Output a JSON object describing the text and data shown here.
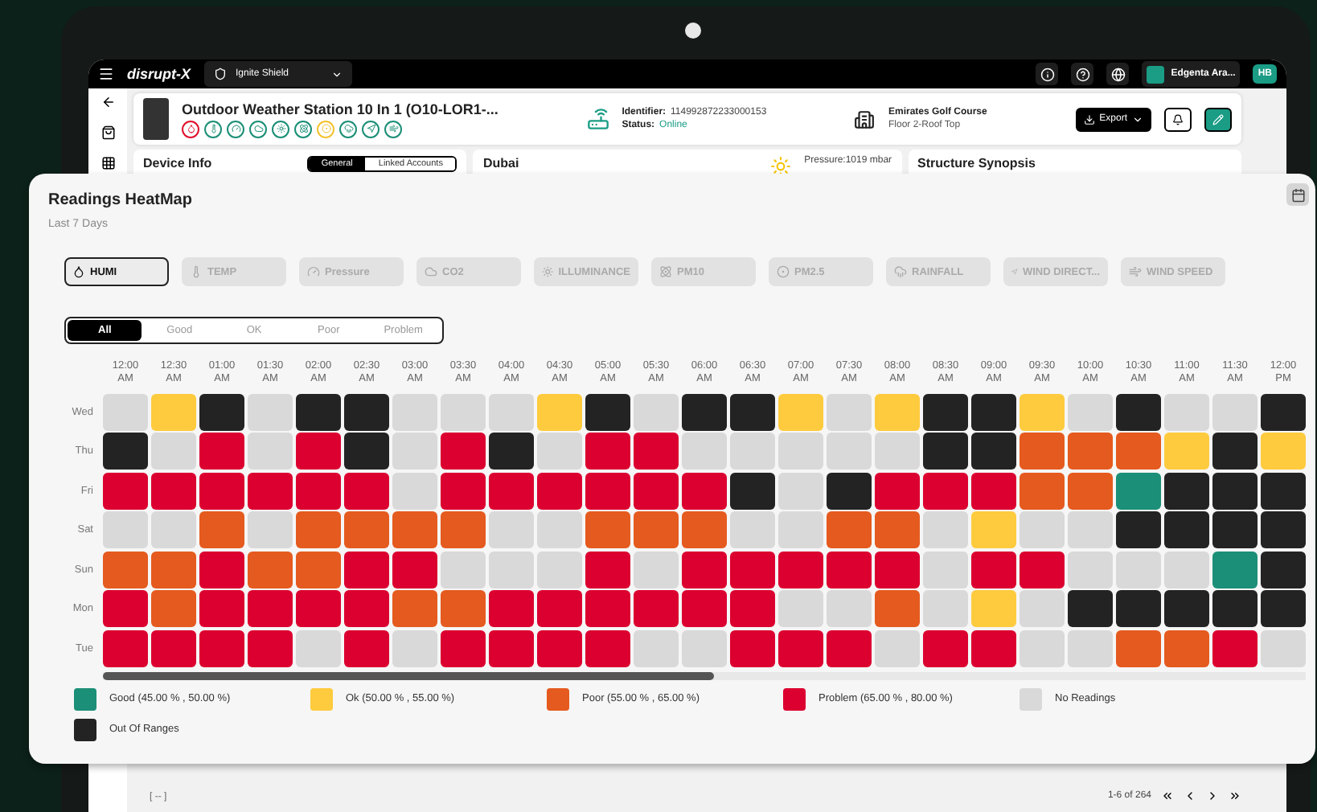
{
  "topbar": {
    "logo": "disrupt-X",
    "site": "Ignite Shield",
    "user": "Edgenta Ara...",
    "initials": "HB"
  },
  "device": {
    "title": "Outdoor Weather Station 10 In 1 (O10-LOR1-...",
    "identifier_label": "Identifier:",
    "identifier": "114992872233000153",
    "status_label": "Status:",
    "status": "Online",
    "location": "Emirates Golf Course",
    "floor": "Floor 2-Roof Top",
    "export": "Export",
    "sensors": [
      {
        "kind": "humi",
        "color": "#e0112b"
      },
      {
        "kind": "temp",
        "color": "#1b8f77"
      },
      {
        "kind": "pressure",
        "color": "#1b8f77"
      },
      {
        "kind": "co2",
        "color": "#1b8f77"
      },
      {
        "kind": "illuminance",
        "color": "#1b8f77"
      },
      {
        "kind": "pm10",
        "color": "#1b8f77"
      },
      {
        "kind": "pm25",
        "color": "#f2c230"
      },
      {
        "kind": "rainfall",
        "color": "#1b8f77"
      },
      {
        "kind": "wind-direction",
        "color": "#1b8f77"
      },
      {
        "kind": "wind-speed",
        "color": "#1b8f77"
      }
    ]
  },
  "panels": {
    "device_info": "Device Info",
    "tabs": [
      {
        "label": "General",
        "selected": true
      },
      {
        "label": "Linked Accounts",
        "selected": false
      }
    ],
    "city": "Dubai",
    "pressure": "Pressure:1019 mbar",
    "synopsis": "Structure Synopsis"
  },
  "heatmap": {
    "title": "Readings HeatMap",
    "subtitle": "Last 7 Days",
    "chips": [
      {
        "label": "HUMI",
        "kind": "humi",
        "selected": true
      },
      {
        "label": "TEMP",
        "kind": "temp",
        "selected": false
      },
      {
        "label": "Pressure",
        "kind": "pressure",
        "selected": false
      },
      {
        "label": "CO2",
        "kind": "co2",
        "selected": false
      },
      {
        "label": "ILLUMINANCE",
        "kind": "illuminance",
        "selected": false
      },
      {
        "label": "PM10",
        "kind": "pm10",
        "selected": false
      },
      {
        "label": "PM2.5",
        "kind": "pm25",
        "selected": false
      },
      {
        "label": "RAINFALL",
        "kind": "rainfall",
        "selected": false
      },
      {
        "label": "WIND DIRECT...",
        "kind": "wind-direction",
        "selected": false
      },
      {
        "label": "WIND SPEED",
        "kind": "wind-speed",
        "selected": false
      }
    ],
    "filters": [
      {
        "label": "All",
        "selected": true
      },
      {
        "label": "Good",
        "selected": false
      },
      {
        "label": "OK",
        "selected": false
      },
      {
        "label": "Poor",
        "selected": false
      },
      {
        "label": "Problem",
        "selected": false
      }
    ],
    "times": [
      "12:00 AM",
      "12:30 AM",
      "01:00 AM",
      "01:30 AM",
      "02:00 AM",
      "02:30 AM",
      "03:00 AM",
      "03:30 AM",
      "04:00 AM",
      "04:30 AM",
      "05:00 AM",
      "05:30 AM",
      "06:00 AM",
      "06:30 AM",
      "07:00 AM",
      "07:30 AM",
      "08:00 AM",
      "08:30 AM",
      "09:00 AM",
      "09:30 AM",
      "10:00 AM",
      "10:30 AM",
      "11:00 AM",
      "11:30 AM",
      "12:00 PM"
    ],
    "rows": [
      {
        "day": "Wed",
        "cells": [
          {
            "kind": "none"
          },
          {
            "kind": "ok"
          },
          {
            "kind": "out"
          },
          {
            "kind": "none"
          },
          {
            "kind": "out"
          },
          {
            "kind": "out"
          },
          {
            "kind": "none"
          },
          {
            "kind": "none"
          },
          {
            "kind": "none"
          },
          {
            "kind": "ok"
          },
          {
            "kind": "out"
          },
          {
            "kind": "none"
          },
          {
            "kind": "out"
          },
          {
            "kind": "out"
          },
          {
            "kind": "ok"
          },
          {
            "kind": "none"
          },
          {
            "kind": "ok"
          },
          {
            "kind": "out"
          },
          {
            "kind": "out"
          },
          {
            "kind": "ok"
          },
          {
            "kind": "none"
          },
          {
            "kind": "out"
          },
          {
            "kind": "none"
          },
          {
            "kind": "none"
          },
          {
            "kind": "out"
          }
        ]
      },
      {
        "day": "Thu",
        "cells": [
          {
            "kind": "out"
          },
          {
            "kind": "none"
          },
          {
            "kind": "problem"
          },
          {
            "kind": "none"
          },
          {
            "kind": "problem"
          },
          {
            "kind": "out"
          },
          {
            "kind": "none"
          },
          {
            "kind": "problem"
          },
          {
            "kind": "out"
          },
          {
            "kind": "none"
          },
          {
            "kind": "problem"
          },
          {
            "kind": "problem"
          },
          {
            "kind": "none"
          },
          {
            "kind": "none"
          },
          {
            "kind": "none"
          },
          {
            "kind": "none"
          },
          {
            "kind": "none"
          },
          {
            "kind": "out"
          },
          {
            "kind": "out"
          },
          {
            "kind": "poor"
          },
          {
            "kind": "poor"
          },
          {
            "kind": "poor"
          },
          {
            "kind": "ok"
          },
          {
            "kind": "out"
          },
          {
            "kind": "ok"
          }
        ]
      },
      {
        "day": "Fri",
        "cells": [
          {
            "kind": "problem"
          },
          {
            "kind": "problem"
          },
          {
            "kind": "problem"
          },
          {
            "kind": "problem"
          },
          {
            "kind": "problem"
          },
          {
            "kind": "problem"
          },
          {
            "kind": "none"
          },
          {
            "kind": "problem"
          },
          {
            "kind": "problem"
          },
          {
            "kind": "problem"
          },
          {
            "kind": "problem"
          },
          {
            "kind": "problem"
          },
          {
            "kind": "problem"
          },
          {
            "kind": "out"
          },
          {
            "kind": "none"
          },
          {
            "kind": "out"
          },
          {
            "kind": "problem"
          },
          {
            "kind": "problem"
          },
          {
            "kind": "problem"
          },
          {
            "kind": "poor"
          },
          {
            "kind": "poor"
          },
          {
            "kind": "good"
          },
          {
            "kind": "out"
          },
          {
            "kind": "out"
          },
          {
            "kind": "out"
          }
        ]
      },
      {
        "day": "Sat",
        "cells": [
          {
            "kind": "none"
          },
          {
            "kind": "none"
          },
          {
            "kind": "poor"
          },
          {
            "kind": "none"
          },
          {
            "kind": "poor"
          },
          {
            "kind": "poor"
          },
          {
            "kind": "poor"
          },
          {
            "kind": "poor"
          },
          {
            "kind": "none"
          },
          {
            "kind": "none"
          },
          {
            "kind": "poor"
          },
          {
            "kind": "poor"
          },
          {
            "kind": "poor"
          },
          {
            "kind": "none"
          },
          {
            "kind": "none"
          },
          {
            "kind": "poor"
          },
          {
            "kind": "poor"
          },
          {
            "kind": "none"
          },
          {
            "kind": "ok"
          },
          {
            "kind": "none"
          },
          {
            "kind": "none"
          },
          {
            "kind": "out"
          },
          {
            "kind": "out"
          },
          {
            "kind": "out"
          },
          {
            "kind": "out"
          }
        ]
      },
      {
        "day": "Sun",
        "cells": [
          {
            "kind": "poor"
          },
          {
            "kind": "poor"
          },
          {
            "kind": "problem"
          },
          {
            "kind": "poor"
          },
          {
            "kind": "poor"
          },
          {
            "kind": "problem"
          },
          {
            "kind": "problem"
          },
          {
            "kind": "none"
          },
          {
            "kind": "none"
          },
          {
            "kind": "none"
          },
          {
            "kind": "problem"
          },
          {
            "kind": "none"
          },
          {
            "kind": "problem"
          },
          {
            "kind": "problem"
          },
          {
            "kind": "problem"
          },
          {
            "kind": "problem"
          },
          {
            "kind": "problem"
          },
          {
            "kind": "none"
          },
          {
            "kind": "problem"
          },
          {
            "kind": "problem"
          },
          {
            "kind": "none"
          },
          {
            "kind": "none"
          },
          {
            "kind": "none"
          },
          {
            "kind": "good"
          },
          {
            "kind": "out"
          }
        ]
      },
      {
        "day": "Mon",
        "cells": [
          {
            "kind": "problem"
          },
          {
            "kind": "poor"
          },
          {
            "kind": "problem"
          },
          {
            "kind": "problem"
          },
          {
            "kind": "problem"
          },
          {
            "kind": "problem"
          },
          {
            "kind": "poor"
          },
          {
            "kind": "poor"
          },
          {
            "kind": "problem"
          },
          {
            "kind": "problem"
          },
          {
            "kind": "problem"
          },
          {
            "kind": "problem"
          },
          {
            "kind": "problem"
          },
          {
            "kind": "problem"
          },
          {
            "kind": "none"
          },
          {
            "kind": "none"
          },
          {
            "kind": "poor"
          },
          {
            "kind": "none"
          },
          {
            "kind": "ok"
          },
          {
            "kind": "none"
          },
          {
            "kind": "out"
          },
          {
            "kind": "out"
          },
          {
            "kind": "out"
          },
          {
            "kind": "out"
          },
          {
            "kind": "out"
          }
        ]
      },
      {
        "day": "Tue",
        "cells": [
          {
            "kind": "problem"
          },
          {
            "kind": "problem"
          },
          {
            "kind": "problem"
          },
          {
            "kind": "problem"
          },
          {
            "kind": "none"
          },
          {
            "kind": "problem"
          },
          {
            "kind": "none"
          },
          {
            "kind": "problem"
          },
          {
            "kind": "problem"
          },
          {
            "kind": "problem"
          },
          {
            "kind": "problem"
          },
          {
            "kind": "none"
          },
          {
            "kind": "none"
          },
          {
            "kind": "problem"
          },
          {
            "kind": "problem"
          },
          {
            "kind": "problem"
          },
          {
            "kind": "none"
          },
          {
            "kind": "problem"
          },
          {
            "kind": "problem"
          },
          {
            "kind": "none"
          },
          {
            "kind": "none"
          },
          {
            "kind": "poor"
          },
          {
            "kind": "poor"
          },
          {
            "kind": "problem"
          },
          {
            "kind": "none"
          }
        ]
      }
    ],
    "legend": [
      {
        "kind": "good",
        "label": "Good (45.00 % , 50.00 %)",
        "color": "#1b8f77"
      },
      {
        "kind": "ok",
        "label": "Ok (50.00 % , 55.00 %)",
        "color": "#fecb3e"
      },
      {
        "kind": "poor",
        "label": "Poor (55.00 % , 65.00 %)",
        "color": "#e55a1e"
      },
      {
        "kind": "problem",
        "label": "Problem (65.00 % , 80.00 %)",
        "color": "#dc0030"
      },
      {
        "kind": "none",
        "label": "No Readings",
        "color": "#d9d9d9"
      },
      {
        "kind": "out",
        "label": "Out Of Ranges",
        "color": "#232323"
      }
    ]
  },
  "footer": {
    "placeholder_text": "[ -- ]",
    "range": "1-6 of 264"
  }
}
